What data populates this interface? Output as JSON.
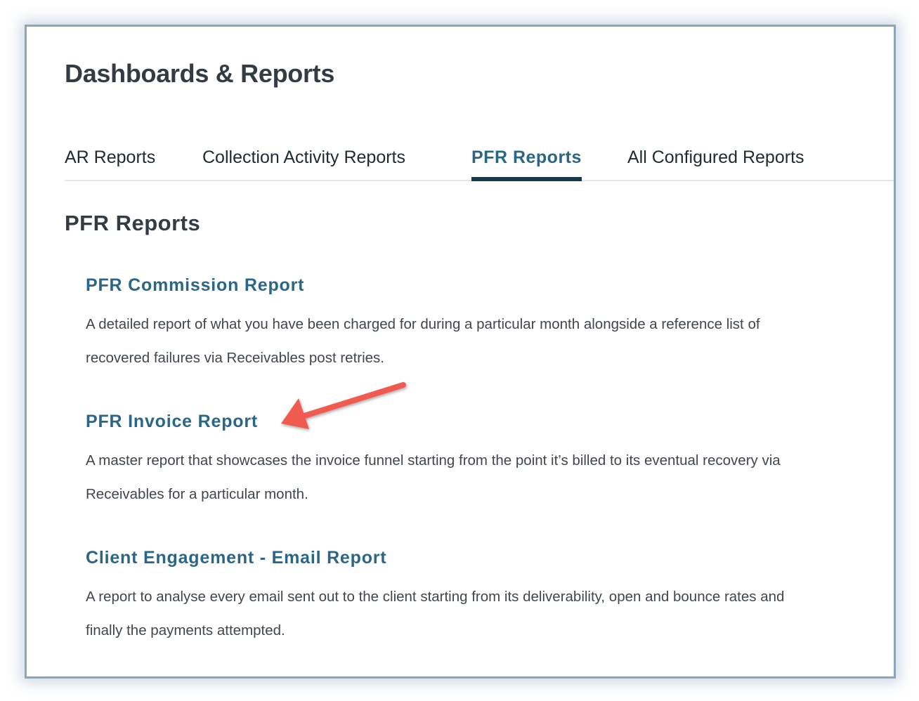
{
  "page": {
    "title": "Dashboards & Reports"
  },
  "tabs": [
    {
      "label": "AR Reports",
      "active": false
    },
    {
      "label": "Collection Activity Reports",
      "active": false
    },
    {
      "label": "PFR Reports",
      "active": true
    },
    {
      "label": "All Configured Reports",
      "active": false
    }
  ],
  "section": {
    "title": "PFR Reports"
  },
  "reports": [
    {
      "title": "PFR Commission Report",
      "description": "A detailed report of what you have been charged for during a particular month alongside a reference list of recovered failures via Receivables post retries."
    },
    {
      "title": "PFR Invoice Report",
      "description": "A master report that showcases the invoice funnel starting from the point it’s billed to its eventual recovery via Receivables for a particular month."
    },
    {
      "title": "Client Engagement - Email Report",
      "description": "A report to analyse every email sent out to the client starting from its deliverability, open and bounce rates and finally the payments attempted."
    }
  ],
  "colors": {
    "accent": "#2a6685",
    "active_tab_underline": "#17394d",
    "annotation_arrow": "#f05a4f",
    "frame_border": "#8aa6bd"
  },
  "annotation": {
    "icon": "arrow-annotation-icon"
  }
}
